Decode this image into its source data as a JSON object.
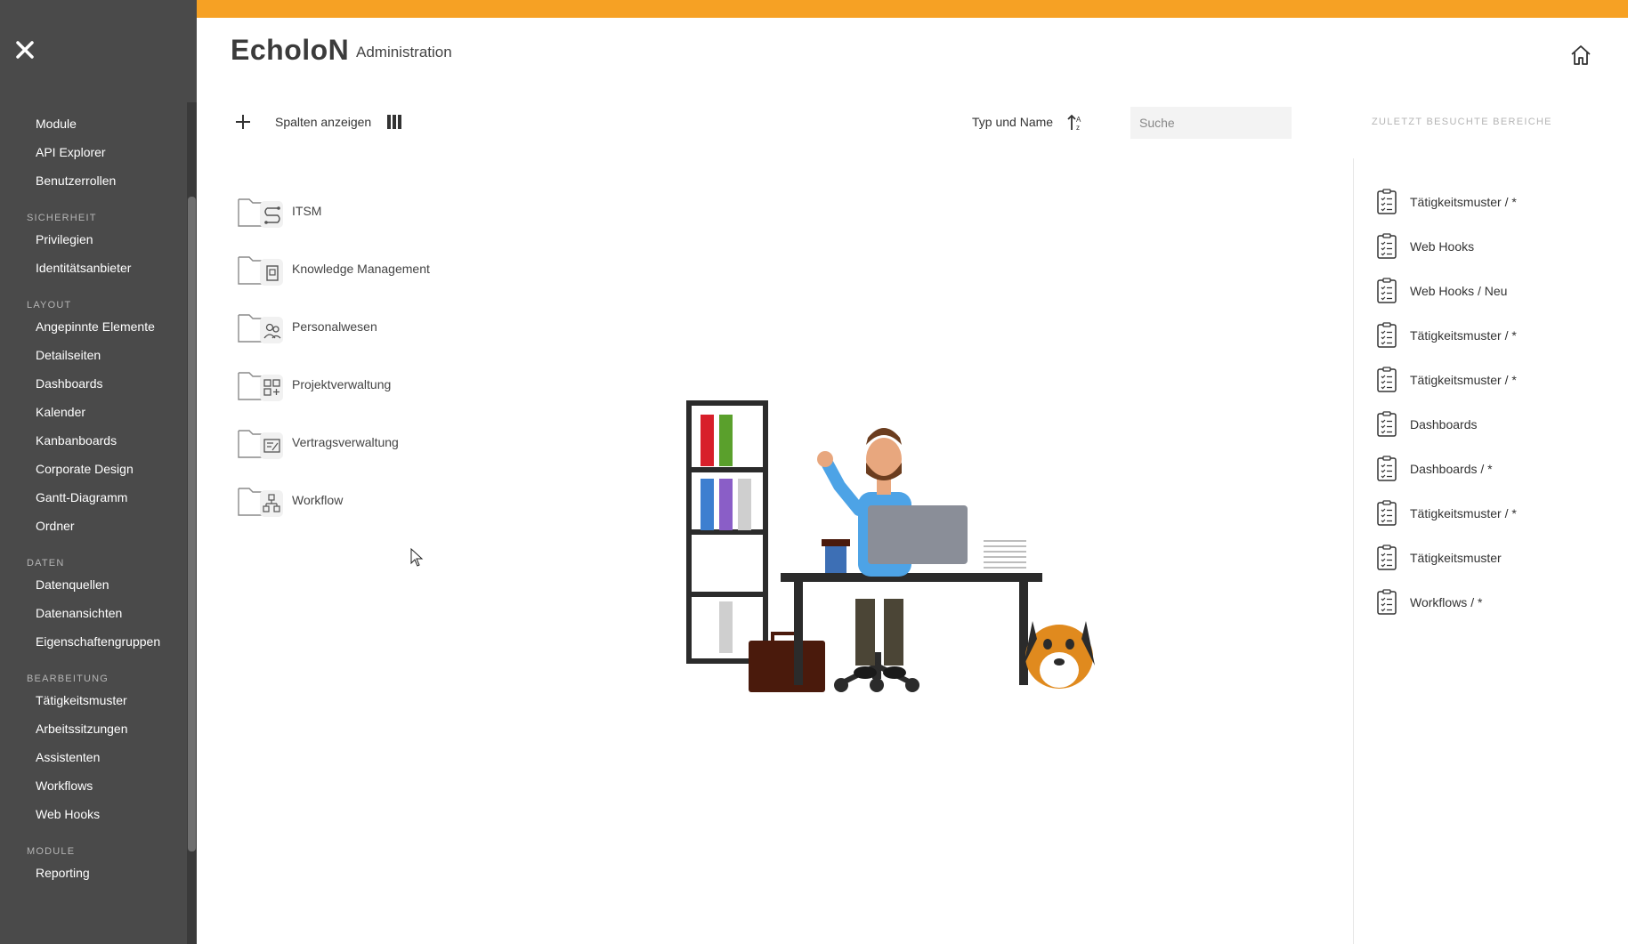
{
  "sidebar": {
    "groups": [
      {
        "section": "",
        "items": [
          "Module",
          "API Explorer",
          "Benutzerrollen"
        ]
      },
      {
        "section": "SICHERHEIT",
        "items": [
          "Privilegien",
          "Identitätsanbieter"
        ]
      },
      {
        "section": "LAYOUT",
        "items": [
          "Angepinnte Elemente",
          "Detailseiten",
          "Dashboards",
          "Kalender",
          "Kanbanboards",
          "Corporate Design",
          "Gantt-Diagramm",
          "Ordner"
        ]
      },
      {
        "section": "DATEN",
        "items": [
          "Datenquellen",
          "Datenansichten",
          "Eigenschaftengruppen"
        ]
      },
      {
        "section": "BEARBEITUNG",
        "items": [
          "Tätigkeitsmuster",
          "Arbeitssitzungen",
          "Assistenten",
          "Workflows",
          "Web Hooks"
        ]
      },
      {
        "section": "MODULE",
        "items": [
          "Reporting"
        ]
      }
    ]
  },
  "header": {
    "app_title": "EcholoN",
    "subtitle": "Administration"
  },
  "toolbar": {
    "columns_label": "Spalten anzeigen",
    "sort_label": "Typ und Name",
    "search_placeholder": "Suche",
    "recent_title": "ZULETZT BESUCHTE BEREICHE"
  },
  "folders": [
    {
      "label": "ITSM",
      "icon": "itsm-icon"
    },
    {
      "label": "Knowledge Management",
      "icon": "knowledge-icon"
    },
    {
      "label": "Personalwesen",
      "icon": "people-icon"
    },
    {
      "label": "Projektverwaltung",
      "icon": "grid-plus-icon"
    },
    {
      "label": "Vertragsverwaltung",
      "icon": "contract-icon"
    },
    {
      "label": "Workflow",
      "icon": "workflow-icon"
    }
  ],
  "recent": [
    "Tätigkeitsmuster / *",
    "Web Hooks",
    "Web Hooks / Neu",
    "Tätigkeitsmuster / *",
    "Tätigkeitsmuster / *",
    "Dashboards",
    "Dashboards / *",
    "Tätigkeitsmuster / *",
    "Tätigkeitsmuster",
    "Workflows / *"
  ],
  "colors": {
    "accent": "#f6a124",
    "sidebar_bg": "#4a4a4a"
  }
}
